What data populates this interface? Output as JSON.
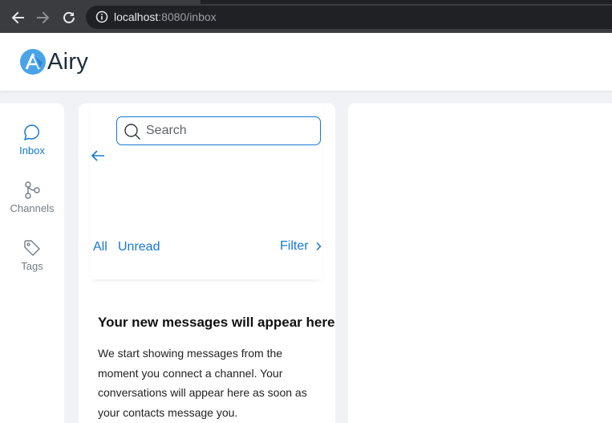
{
  "browser": {
    "url_host": "localhost",
    "url_rest": ":8080/inbox"
  },
  "app": {
    "name": "Airy"
  },
  "sidebar": {
    "items": [
      {
        "label": "Inbox",
        "icon": "chat-bubble-icon",
        "active": true
      },
      {
        "label": "Channels",
        "icon": "channels-icon",
        "active": false
      },
      {
        "label": "Tags",
        "icon": "tag-icon",
        "active": false
      }
    ]
  },
  "inbox": {
    "search_placeholder": "Search",
    "tabs": {
      "all": "All",
      "unread": "Unread"
    },
    "filter_label": "Filter",
    "empty_title": "Your new messages will appear here",
    "empty_body": "We start showing messages from the moment you connect a channel. Your conversations will appear here as soon as your contacts message you."
  },
  "colors": {
    "accent": "#1578d4",
    "background": "#f1f2f5"
  }
}
